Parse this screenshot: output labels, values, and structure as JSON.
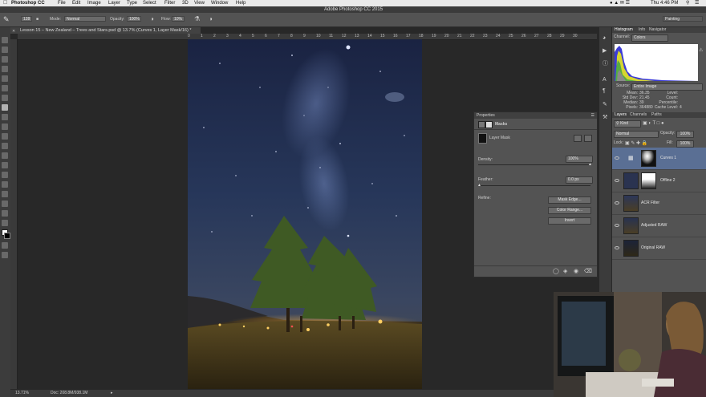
{
  "menubar": {
    "apple": "",
    "app": "Photoshop CC",
    "items": [
      "File",
      "Edit",
      "Image",
      "Layer",
      "Type",
      "Select",
      "Filter",
      "3D",
      "View",
      "Window",
      "Help"
    ],
    "clock": "Thu 4:46 PM"
  },
  "window_title": "Adobe Photoshop CC 2015",
  "options": {
    "size": "128",
    "mode_label": "Mode:",
    "mode_value": "Normal",
    "opacity_label": "Opacity:",
    "opacity_value": "100%",
    "flow_label": "Flow:",
    "flow_value": "10%",
    "workspace": "Painting"
  },
  "document": {
    "tab": "Lesson 15 – New Zealand – Trees and Stars.psd @ 13.7% (Curves 1, Layer Mask/16) *",
    "ruler_ticks": [
      "0",
      "1",
      "2",
      "3",
      "4",
      "5",
      "6",
      "7",
      "8",
      "9",
      "10",
      "11",
      "12",
      "13",
      "14",
      "15",
      "16",
      "17",
      "18",
      "19",
      "20",
      "21",
      "22",
      "23",
      "24",
      "25",
      "26",
      "27",
      "28",
      "29",
      "30"
    ]
  },
  "status": {
    "zoom": "13.71%",
    "doc": "Doc: 208.8M/938.1M"
  },
  "properties": {
    "title": "Properties",
    "section": "Masks",
    "mask_type": "Layer Mask",
    "density_label": "Density:",
    "density_value": "100%",
    "feather_label": "Feather:",
    "feather_value": "0.0 px",
    "refine_label": "Refine:",
    "buttons": [
      "Mask Edge...",
      "Color Range...",
      "Invert"
    ]
  },
  "histogram": {
    "tabs": [
      "Histogram",
      "Info",
      "Navigator"
    ],
    "channel_label": "Channel:",
    "channel_value": "Colors",
    "source_label": "Source:",
    "source_value": "Entire Image",
    "stats_left": [
      {
        "label": "Mean:",
        "value": "36.35"
      },
      {
        "label": "Std Dev:",
        "value": "21.45"
      },
      {
        "label": "Median:",
        "value": "39"
      },
      {
        "label": "Pixels:",
        "value": "364880"
      }
    ],
    "stats_right": [
      {
        "label": "Level:",
        "value": ""
      },
      {
        "label": "Count:",
        "value": ""
      },
      {
        "label": "Percentile:",
        "value": ""
      },
      {
        "label": "Cache Level:",
        "value": "4"
      }
    ]
  },
  "layers": {
    "tabs": [
      "Layers",
      "Channels",
      "Paths"
    ],
    "kind": "Kind",
    "blend": "Normal",
    "opacity_label": "Opacity:",
    "opacity_value": "100%",
    "lock_label": "Lock:",
    "fill_label": "Fill:",
    "fill_value": "100%",
    "items": [
      {
        "name": "Curves 1",
        "selected": true
      },
      {
        "name": "Offline 2",
        "selected": false
      },
      {
        "name": "ACR Filter",
        "selected": false
      },
      {
        "name": "Adjusted RAW",
        "selected": false
      },
      {
        "name": "Original RAW",
        "selected": false
      }
    ]
  },
  "colors": {
    "accent": "#5a6f94",
    "panel": "#535353",
    "canvas_bg": "#282828"
  }
}
